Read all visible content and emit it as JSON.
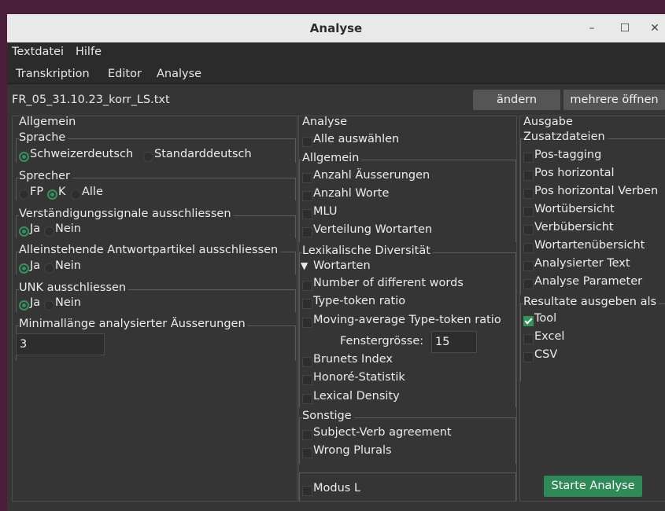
{
  "window": {
    "title": "Analyse",
    "minimize": "–",
    "maximize": "☐",
    "close": "✕"
  },
  "menu": {
    "file": "Textdatei",
    "help": "Hilfe"
  },
  "tabs": {
    "t1": "Transkription",
    "t2": "Editor",
    "t3": "Analyse"
  },
  "file": {
    "name": "FR_05_31.10.23_korr_LS.txt",
    "change_button": "ändern",
    "open_multiple_button": "mehrere öffnen"
  },
  "general": {
    "title": "Allgemein",
    "language": {
      "title": "Sprache",
      "opt1": "Schweizerdeutsch",
      "opt2": "Standarddeutsch",
      "selected": "Schweizerdeutsch"
    },
    "speaker": {
      "title": "Sprecher",
      "opt1": "FP",
      "opt2": "K",
      "opt3": "Alle",
      "selected": "K"
    },
    "signals": {
      "title": "Verständigungssignale ausschliessen",
      "yes": "Ja",
      "no": "Nein",
      "selected": "Ja"
    },
    "particles": {
      "title": "Alleinstehende Antwortpartikel ausschliessen",
      "yes": "Ja",
      "no": "Nein",
      "selected": "Ja"
    },
    "unk": {
      "title": "UNK ausschliessen",
      "yes": "Ja",
      "no": "Nein",
      "selected": "Ja"
    },
    "minlen": {
      "title": "Minimallänge analysierter Äusserungen",
      "value": "3"
    }
  },
  "analysis": {
    "title": "Analyse",
    "select_all": "Alle auswählen",
    "general_title": "Allgemein",
    "g1": "Anzahl Äusserungen",
    "g2": "Anzahl Worte",
    "g3": "MLU",
    "g4": "Verteilung Wortarten",
    "lex_title": "Lexikalische Diversität",
    "wortarten": "Wortarten",
    "l1": "Number of different words",
    "l2": "Type-token ratio",
    "l3": "Moving-average Type-token ratio",
    "window_label": "Fenstergrösse:",
    "window_value": "15",
    "l4": "Brunets Index",
    "l5": "Honoré-Statistik",
    "l6": "Lexical Density",
    "other_title": "Sonstige",
    "o1": "Subject-Verb agreement",
    "o2": "Wrong Plurals",
    "modus": "Modus L"
  },
  "output": {
    "title": "Ausgabe",
    "extra_title": "Zusatzdateien",
    "e1": "Pos-tagging",
    "e2": "Pos horizontal",
    "e3": "Pos horizontal Verben",
    "e4": "Wortübersicht",
    "e5": "Verbübersicht",
    "e6": "Wortartenübersicht",
    "e7": "Analysierter Text",
    "e8": "Analyse Parameter",
    "result_title": "Resultate ausgeben als",
    "r1": "Tool",
    "r2": "Excel",
    "r3": "CSV",
    "start_button": "Starte Analyse"
  }
}
